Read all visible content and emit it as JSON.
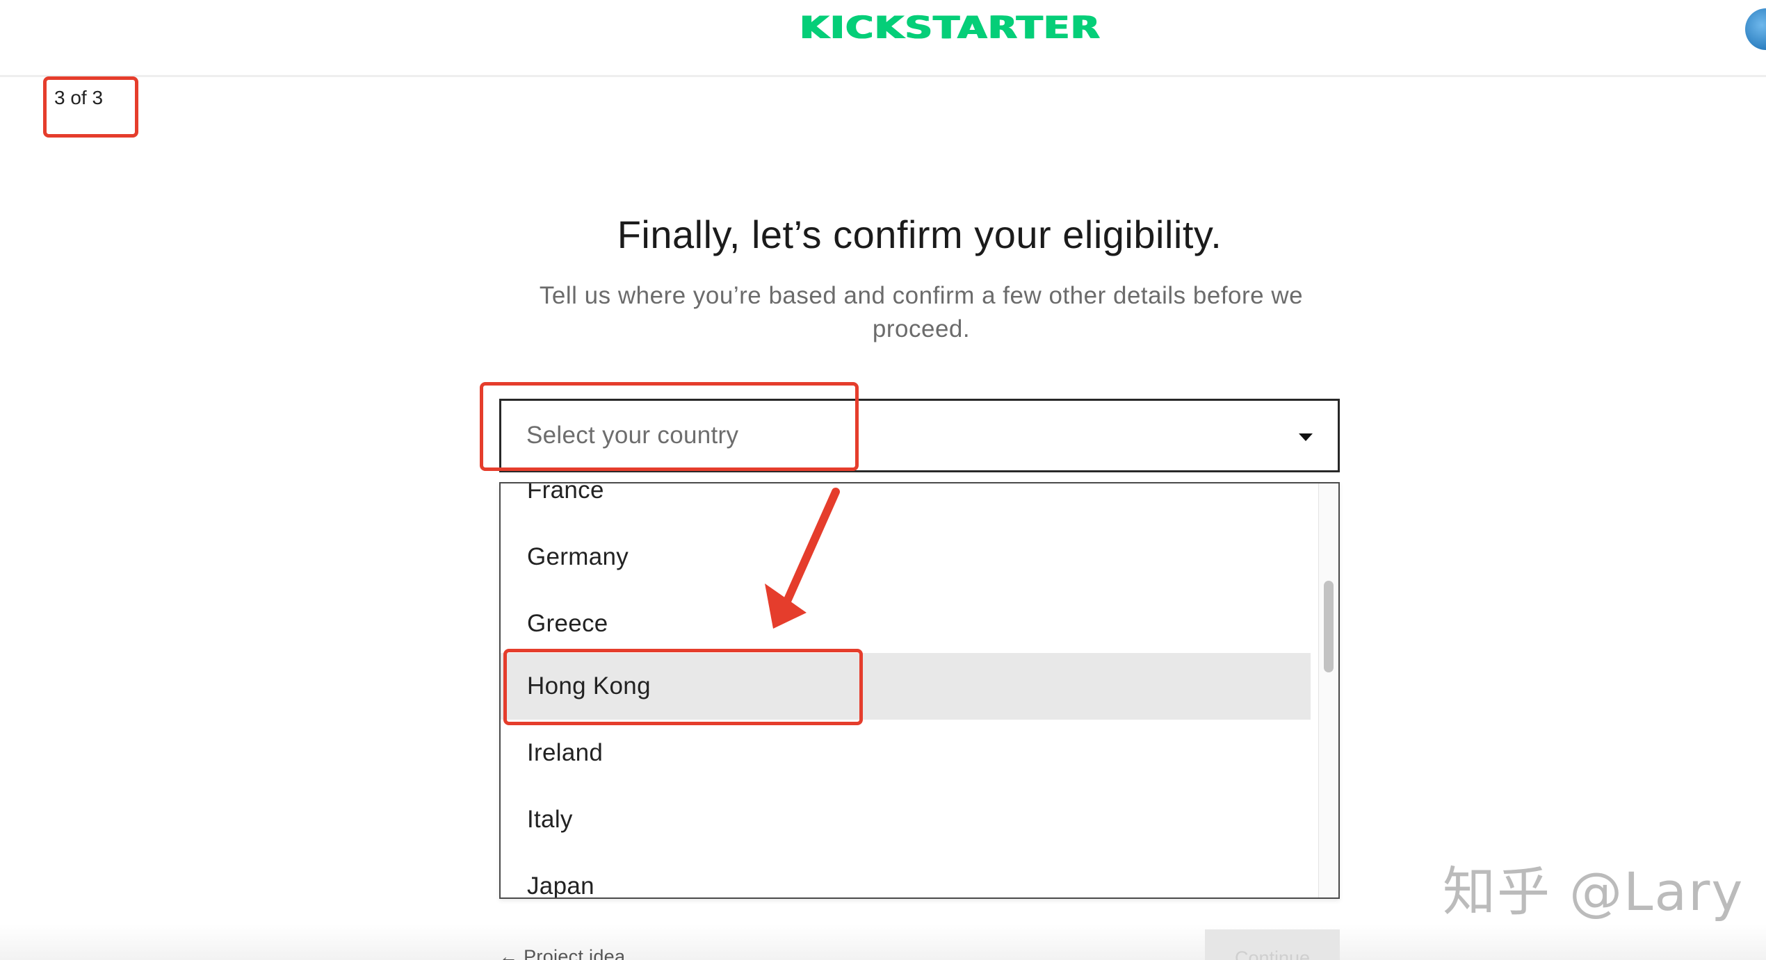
{
  "header": {
    "logo_text": "KICKSTARTER",
    "brand_color": "#05ce78",
    "avatar_icon": "user-avatar-icon"
  },
  "progress": {
    "step_label": "3 of 3"
  },
  "content": {
    "title": "Finally, let’s confirm your eligibility.",
    "subtitle": "Tell us where you’re based and confirm a few other details before we proceed."
  },
  "country_select": {
    "placeholder": "Select your country",
    "caret_icon": "caret-down-icon",
    "options": [
      "France",
      "Germany",
      "Greece",
      "Hong Kong",
      "Ireland",
      "Italy",
      "Japan"
    ],
    "highlighted": "Hong Kong"
  },
  "footer": {
    "back_label": "← Project idea",
    "continue_label": "Continue"
  },
  "annotations": {
    "highlight_color": "#e53d2c"
  },
  "watermark": {
    "text": "知乎 @Lary"
  }
}
